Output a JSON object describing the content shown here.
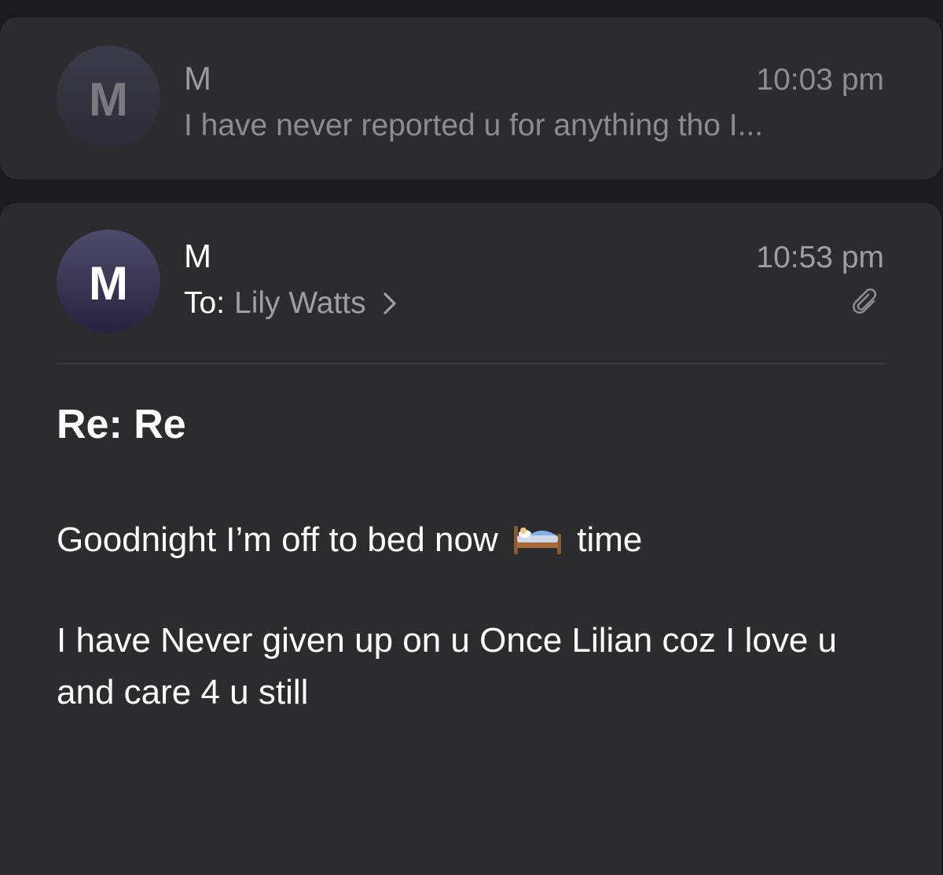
{
  "messages": [
    {
      "avatar_initial": "M",
      "sender": "M",
      "time": "10:03 pm",
      "preview": "I have never reported u for anything tho I..."
    },
    {
      "avatar_initial": "M",
      "sender": "M",
      "time": "10:53 pm",
      "to_label": "To:",
      "recipient": "Lily Watts",
      "subject": "Re: Re",
      "body_line1_before": "Goodnight I’m off to bed now",
      "body_line1_after": "time",
      "body_paragraph2": "I have Never given up on u Once Lilian coz I love u and care 4 u still"
    }
  ],
  "icons": {
    "chevron": "chevron-right-icon",
    "attachment": "paperclip-icon",
    "bed": "bed-emoji"
  },
  "colors": {
    "background": "#1b1b1d",
    "card": "#2c2c2e",
    "secondary_text": "#9e9ea4",
    "primary_text": "#ffffff"
  }
}
